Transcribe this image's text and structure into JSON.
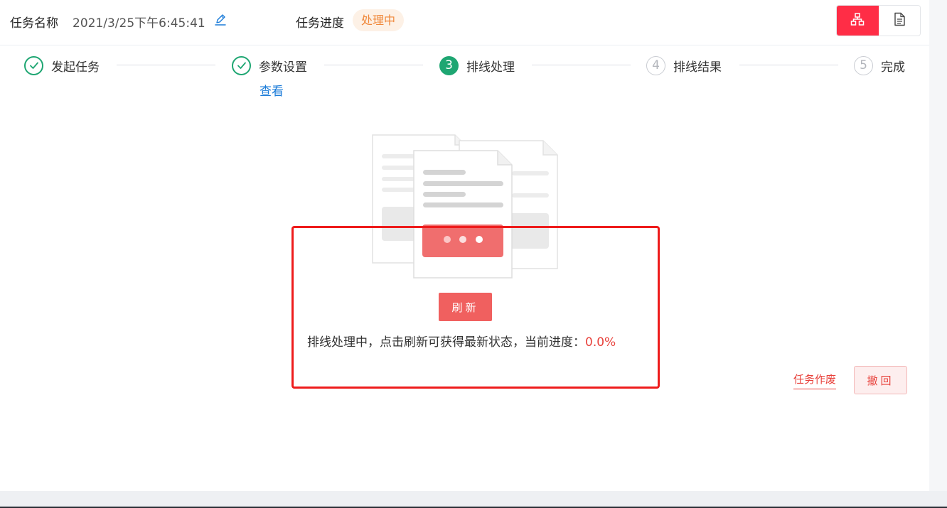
{
  "header": {
    "task_name_label": "任务名称",
    "task_name_value": "2021/3/25下午6:45:41",
    "progress_label": "任务进度",
    "progress_status": "处理中"
  },
  "toolbar": {
    "icons": [
      "org-chart-icon",
      "document-icon"
    ]
  },
  "steps": [
    {
      "number": "1",
      "label": "发起任务",
      "state": "done"
    },
    {
      "number": "2",
      "label": "参数设置",
      "state": "done",
      "link": "查看"
    },
    {
      "number": "3",
      "label": "排线处理",
      "state": "current"
    },
    {
      "number": "4",
      "label": "排线结果",
      "state": "todo"
    },
    {
      "number": "5",
      "label": "完成",
      "state": "todo"
    }
  ],
  "main": {
    "refresh_label": "刷新",
    "message": "排线处理中，点击刷新可获得最新状态，当前进度：",
    "progress_value": "0.0%"
  },
  "actions": {
    "void_label": "任务作废",
    "revoke_label": "撤回"
  },
  "colors": {
    "accent": "#ff2d46",
    "success": "#1ea672",
    "link": "#1a7bd8",
    "warning": "#f0883a",
    "danger": "#e8413b"
  }
}
